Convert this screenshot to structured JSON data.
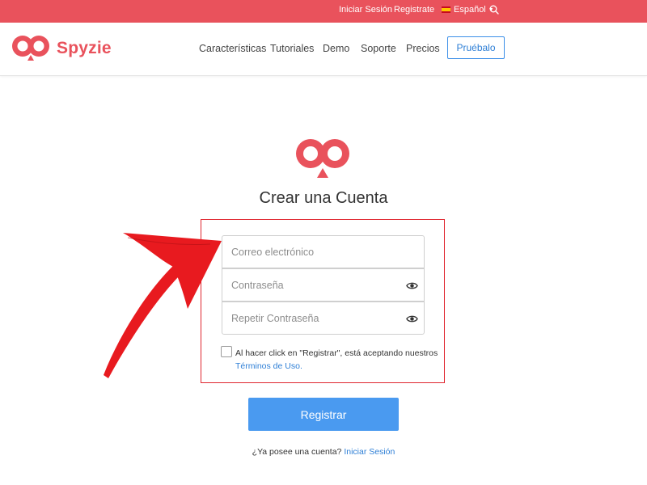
{
  "colors": {
    "brand": "#e9525c",
    "accent": "#4a9af0",
    "link": "#2e7fd6",
    "highlight": "#e0262f"
  },
  "topbar": {
    "login": "Iniciar Sesión",
    "register": "Registrate",
    "language": "Español",
    "search_icon": "search-icon"
  },
  "header": {
    "brand": "Spyzie",
    "nav": [
      "Características",
      "Tutoriales",
      "Demo",
      "Soporte",
      "Precios"
    ],
    "try_button": "Pruébalo"
  },
  "form": {
    "title": "Crear una Cuenta",
    "email_placeholder": "Correo electrónico",
    "password_placeholder": "Contraseña",
    "repeat_password_placeholder": "Repetir Contraseña",
    "eye_icon": "eye-icon",
    "terms_text": "Al hacer click en \"Registrar\", está aceptando nuestros",
    "terms_link": "Términos de Uso.",
    "submit": "Registrar",
    "have_account": "¿Ya posee una cuenta?",
    "login_link": "Iniciar Sesión"
  }
}
